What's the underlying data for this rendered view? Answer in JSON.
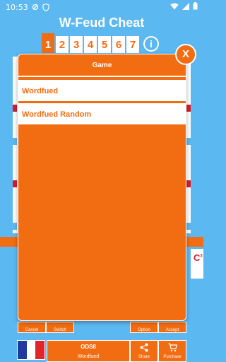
{
  "status_bar": {
    "time": "10:53"
  },
  "app": {
    "title": "W-Feud Cheat"
  },
  "tabs": [
    {
      "label": "1"
    },
    {
      "label": "2"
    },
    {
      "label": "3"
    },
    {
      "label": "4"
    },
    {
      "label": "5"
    },
    {
      "label": "6"
    },
    {
      "label": "7"
    }
  ],
  "active_tab": "1",
  "info_label": "i",
  "side_card": {
    "letter": "C",
    "score": "3"
  },
  "buttons": {
    "cancel": "Cancel",
    "switch": "Switch",
    "option": "Option",
    "accept": "Accept",
    "share": "Share",
    "purchase": "Purchase"
  },
  "dictionary": {
    "code": "ODS8",
    "game": "Wordfued"
  },
  "language": {
    "flag": "france-flag-icon",
    "colors": [
      "#1e3a9e",
      "#ffffff",
      "#e0252b"
    ]
  },
  "modal": {
    "title": "Game",
    "options": [
      "Wordfued",
      "Wordfued Random"
    ],
    "close_label": "X"
  },
  "colors": {
    "accent": "#f26c12",
    "background": "#5cb8f0"
  }
}
